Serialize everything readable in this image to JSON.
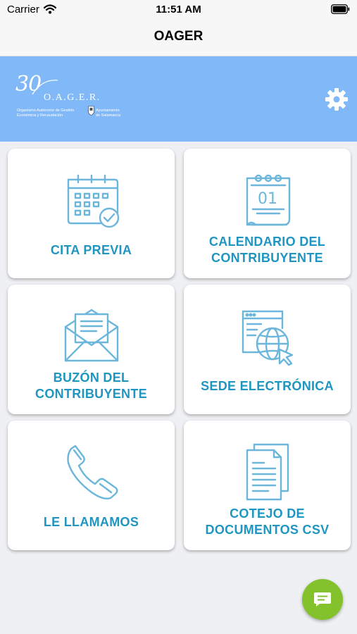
{
  "status_bar": {
    "carrier": "Carrier",
    "time": "11:51 AM"
  },
  "nav": {
    "title": "OAGER"
  },
  "header": {
    "logo": {
      "number": "30",
      "name": "O.A.G.E.R.",
      "org_line1": "Organismo Autónomo de Gestión",
      "org_line2": "Económica y Recaudación",
      "city_line1": "Ayuntamiento",
      "city_line2": "de Salamanca"
    },
    "settings_icon": "gear-icon"
  },
  "tiles": [
    {
      "line1": "CITA PREVIA",
      "line2": "",
      "icon": "calendar-check-icon"
    },
    {
      "line1": "CALENDARIO DEL",
      "line2": "CONTRIBUYENTE",
      "icon": "desk-calendar-icon"
    },
    {
      "line1": "BUZÓN DEL",
      "line2": "CONTRIBUYENTE",
      "icon": "envelope-letter-icon"
    },
    {
      "line1": "SEDE ELECTRÓNICA",
      "line2": "",
      "icon": "browser-globe-icon"
    },
    {
      "line1": "LE LLAMAMOS",
      "line2": "",
      "icon": "phone-icon"
    },
    {
      "line1": "COTEJO DE",
      "line2": "DOCUMENTOS CSV",
      "icon": "documents-icon"
    }
  ],
  "chat_button": {
    "icon": "chat-icon"
  },
  "colors": {
    "banner": "#81b9f8",
    "accent": "#1f96c1",
    "fab": "#84c22b",
    "icon_stroke": "#6cb6dc"
  }
}
